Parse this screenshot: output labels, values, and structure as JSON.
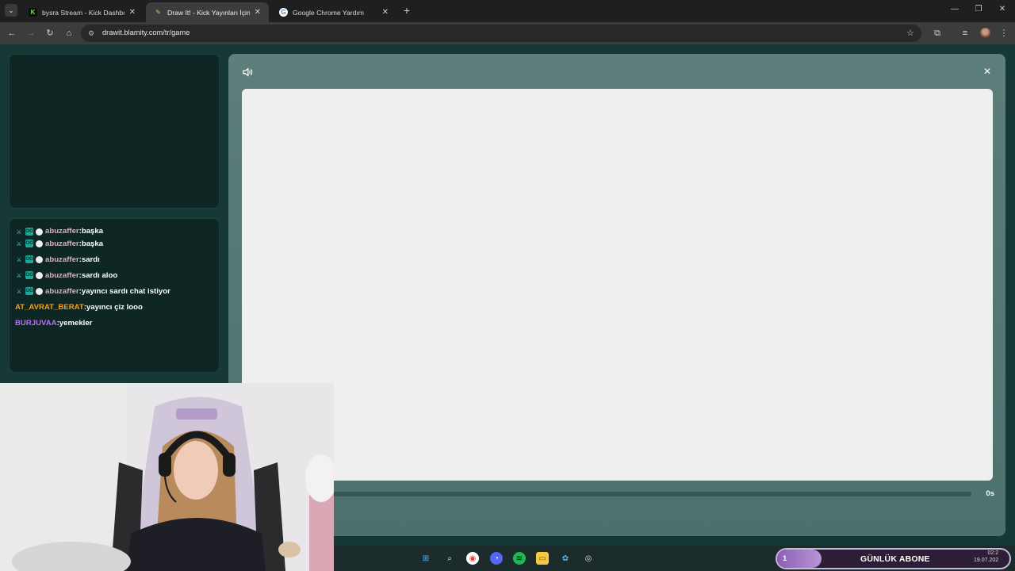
{
  "browser": {
    "tabs": [
      {
        "label": "bysra Stream - Kick Dashboard",
        "favicon": "kick-logo-icon",
        "active": false
      },
      {
        "label": "Draw It! - Kick Yayınları İçin Çizi",
        "favicon": "drawit-logo-icon",
        "active": true
      },
      {
        "label": "Google Chrome Yardım",
        "favicon": "google-logo-icon",
        "active": false
      }
    ],
    "new_tab": "+",
    "url": "drawit.blamity.com/tr/game"
  },
  "chat": {
    "messages": [
      {
        "user": "abuzaffer",
        "message": "başka",
        "badges": true,
        "color": "#e4a7c7"
      },
      {
        "user": "abuzaffer",
        "message": "başka",
        "badges": true,
        "color": "#e4a7c7"
      },
      {
        "user": "abuzaffer",
        "message": "sardı",
        "badges": true,
        "color": "#e4a7c7"
      },
      {
        "user": "abuzaffer",
        "message": "sardı aloo",
        "badges": true,
        "color": "#e4a7c7"
      },
      {
        "user": "abuzaffer",
        "message": "yayıncı sardı chat istiyor",
        "badges": true,
        "color": "#e4a7c7"
      },
      {
        "user": "AT_AVRAT_BERAT",
        "message": "yayıncı çiz looo",
        "badges": false,
        "color": "#f0a21e"
      },
      {
        "user": "BURJUVAA",
        "message": "yemekler",
        "badges": false,
        "color": "#b770f0"
      }
    ]
  },
  "game": {
    "timer": "0s",
    "sound_icon": "speaker-icon",
    "close_icon": "close-icon",
    "canvas_color": "#efefef"
  },
  "stream_goal": {
    "count": "1",
    "label": "GÜNLÜK ABONE",
    "progress": 0.19
  },
  "system_tray": {
    "time": "02:2",
    "date": "19.07.202"
  }
}
